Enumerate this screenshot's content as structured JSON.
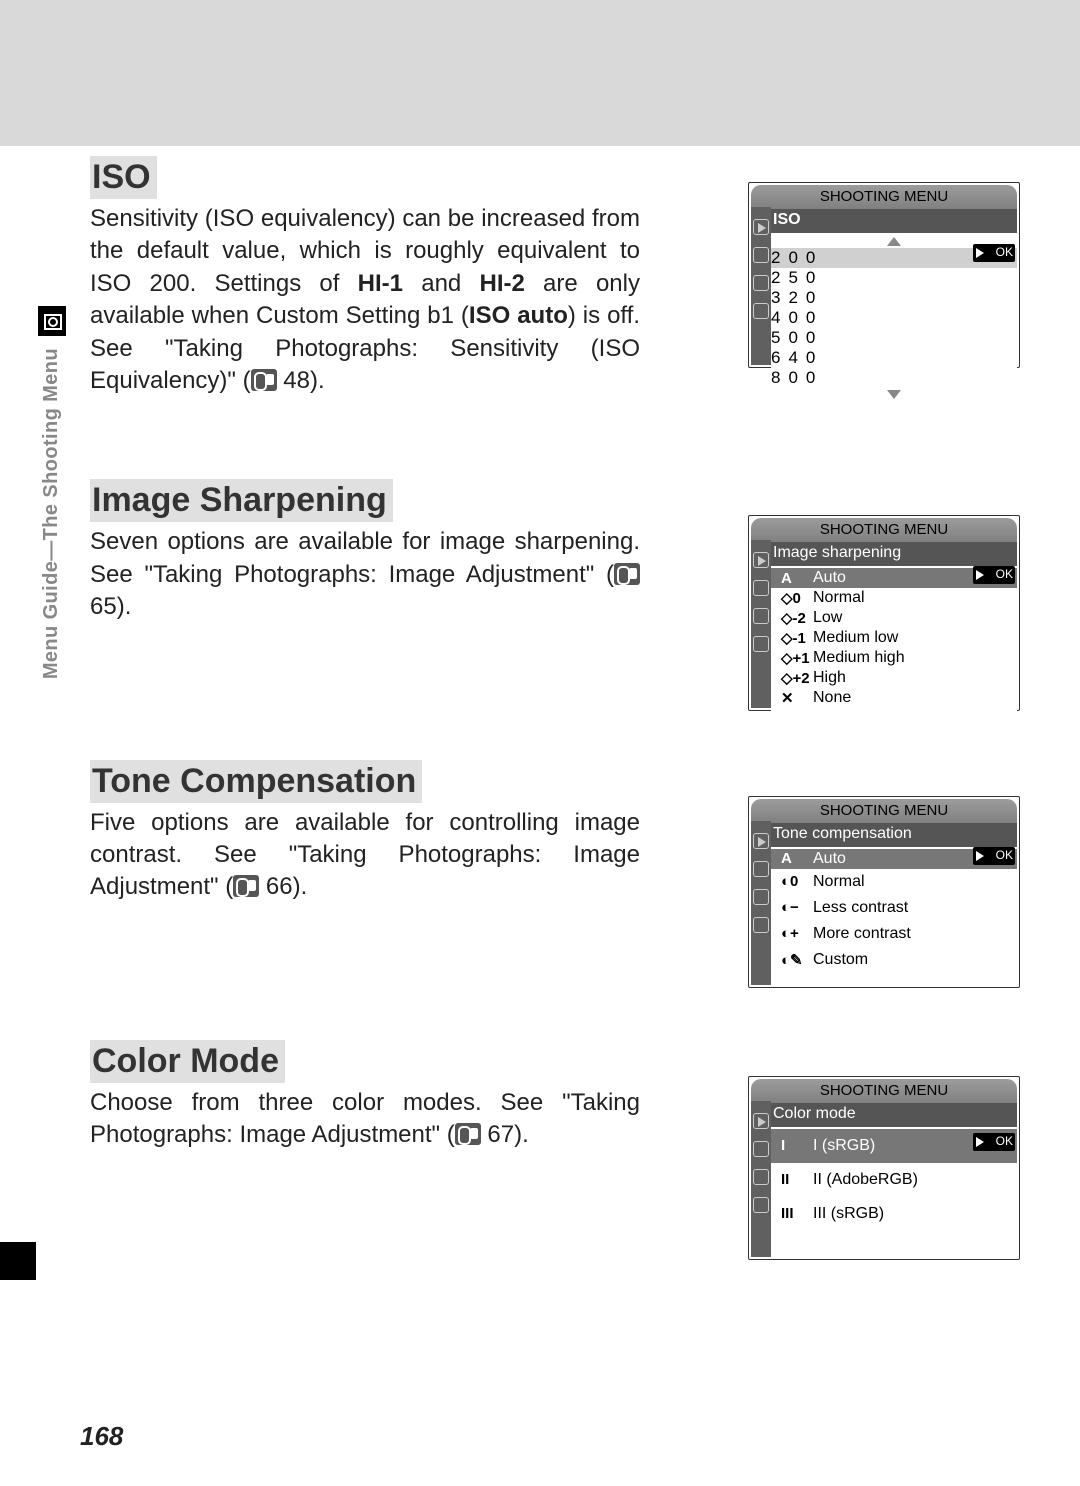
{
  "side_tab": "Menu Guide—The Shooting Menu",
  "page_number": "168",
  "sections": {
    "iso": {
      "heading": "ISO",
      "body_1": "Sensitivity (ISO equivalency) can be increased from the default value, which is roughly equivalent to ISO 200.  Settings of ",
      "b1": "HI-1",
      "body_2": " and ",
      "b2": "HI-2",
      "body_3": " are only available when Custom Setting b1 (",
      "b3": "ISO auto",
      "body_4": ") is off. See \"Taking Photographs: Sensitivity (ISO Equivalency)\" (",
      "ref": " 48)."
    },
    "sharpen": {
      "heading": "Image Sharpening",
      "body_1": "Seven options are available for image sharpening. See \"Taking Photographs: Image Adjustment\" (",
      "ref": " 65)."
    },
    "tone": {
      "heading": "Tone Compensation",
      "body_1": "Five options are available for controlling image contrast.  See \"Taking Photographs: Image Adjustment\" (",
      "ref": " 66)."
    },
    "color": {
      "heading": "Color Mode",
      "body_1": "Choose from three color modes.  See \"Taking Photographs: Image Adjustment\" (",
      "ref": " 67)."
    }
  },
  "menus": {
    "title": "SHOOTING MENU",
    "ok": "OK",
    "iso": {
      "subtitle": "ISO",
      "items": [
        "200",
        "250",
        "320",
        "400",
        "500",
        "640",
        "800"
      ]
    },
    "sharpen": {
      "subtitle": "Image sharpening",
      "items": [
        {
          "icon": "A",
          "label": "Auto"
        },
        {
          "icon": "◇0",
          "label": "Normal"
        },
        {
          "icon": "◇-2",
          "label": "Low"
        },
        {
          "icon": "◇-1",
          "label": "Medium low"
        },
        {
          "icon": "◇+1",
          "label": "Medium high"
        },
        {
          "icon": "◇+2",
          "label": "High"
        },
        {
          "icon": "✕",
          "label": "None"
        }
      ]
    },
    "tone": {
      "subtitle": "Tone compensation",
      "items": [
        {
          "icon": "A",
          "label": "Auto"
        },
        {
          "icon": "◐0",
          "label": "Normal"
        },
        {
          "icon": "◐−",
          "label": "Less contrast"
        },
        {
          "icon": "◐+",
          "label": "More contrast"
        },
        {
          "icon": "◐✎",
          "label": "Custom"
        }
      ]
    },
    "color": {
      "subtitle": "Color mode",
      "items": [
        {
          "icon": "I",
          "label": "I  (sRGB)"
        },
        {
          "icon": "II",
          "label": "II  (AdobeRGB)"
        },
        {
          "icon": "III",
          "label": "III  (sRGB)"
        }
      ]
    }
  }
}
